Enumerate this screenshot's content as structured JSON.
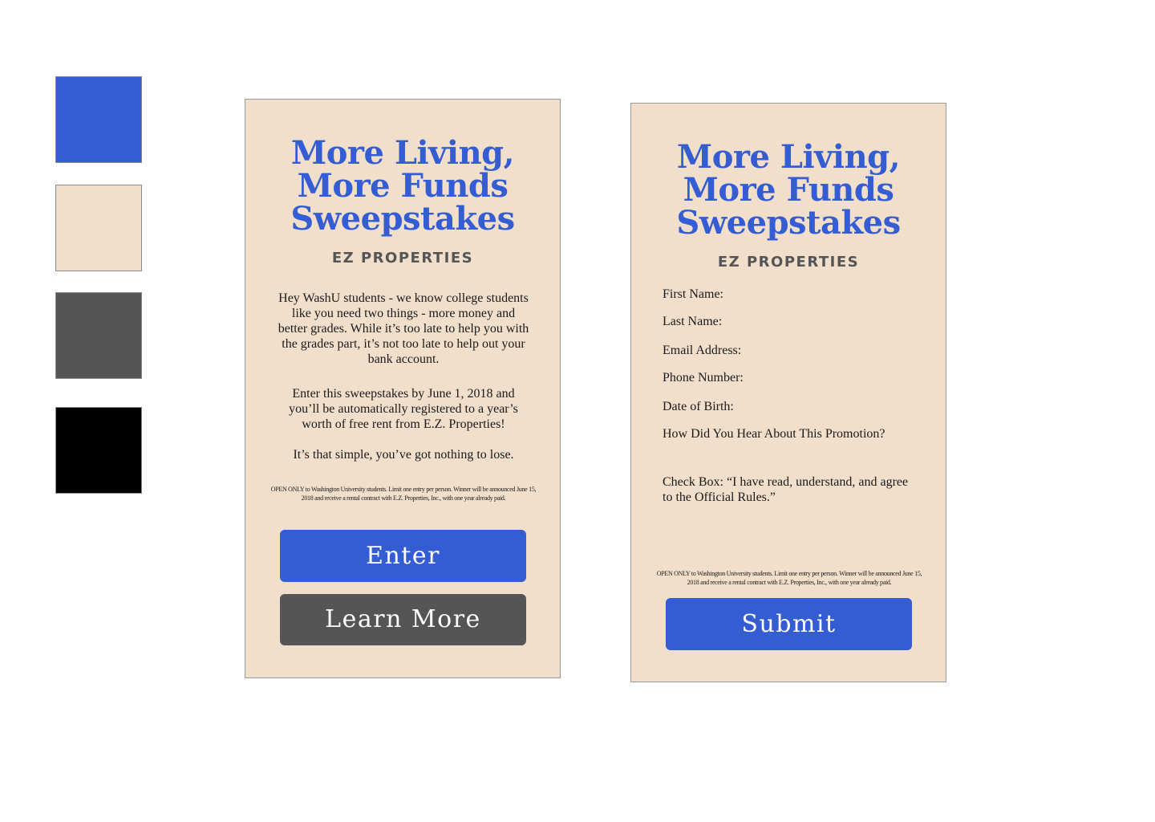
{
  "palette": {
    "colors": [
      "#355dd3",
      "#f1dfcb",
      "#555555",
      "#000000"
    ]
  },
  "title_lines": [
    "More Living,",
    "More Funds",
    "Sweepstakes"
  ],
  "brand": "EZ PROPERTIES",
  "landing": {
    "intro": "Hey WashU students - we know college students like you need two things - more money and better grades. While it’s too late to help you with the grades part, it’s not too late to help out your bank account.",
    "details": "Enter this sweepstakes by June 1, 2018 and you’ll be automatically registered to a year’s worth of free rent from E.Z. Properties!",
    "closing": "It’s that simple, you’ve got nothing to lose.",
    "fine_print": "OPEN ONLY to Washington University students. Limit one entry per person. Winner will be announced June 15, 2018 and receive a rental contract with E.Z. Properties, Inc., with one year already paid.",
    "enter_label": "Enter",
    "learn_more_label": "Learn More"
  },
  "form": {
    "first_name": "First Name:",
    "last_name": "Last Name:",
    "email": "Email Address:",
    "phone": "Phone Number:",
    "dob": "Date of Birth:",
    "hear": "How Did You Hear About This Promotion?",
    "agree": "Check Box: “I have read, understand, and agree to the Official Rules.”",
    "fine_print": "OPEN ONLY to Washington University students. Limit one entry per person. Winner will be announced June 15, 2018 and receive a rental contract with E.Z. Properties, Inc., with one year already paid.",
    "submit_label": "Submit"
  }
}
